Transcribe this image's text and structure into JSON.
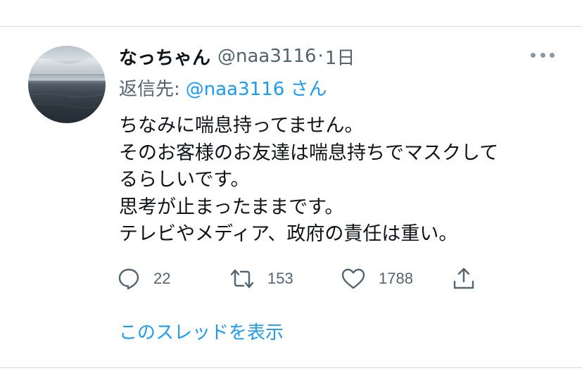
{
  "tweet": {
    "display_name": "なっちゃん",
    "handle": "@naa3116",
    "separator": "·",
    "time": "1日",
    "reply_label": "返信先:",
    "reply_handle": "@naa3116 さん",
    "lines": [
      "ちなみに喘息持ってません。",
      "そのお客様のお友達は喘息持ちでマスクして",
      "るらしいです。",
      "思考が止まったままです。",
      "テレビやメディア、政府の責任は重い。"
    ],
    "counts": {
      "replies": "22",
      "retweets": "153",
      "likes": "1788"
    },
    "thread_link": "このスレッドを表示"
  },
  "icons": {
    "more": "more-dots-icon",
    "reply": "reply-bubble-icon",
    "retweet": "retweet-icon",
    "like": "heart-icon",
    "share": "share-icon"
  },
  "colors": {
    "text": "#0f1419",
    "secondary": "#536471",
    "link": "#1d9bf0",
    "divider": "#cfd9de"
  }
}
